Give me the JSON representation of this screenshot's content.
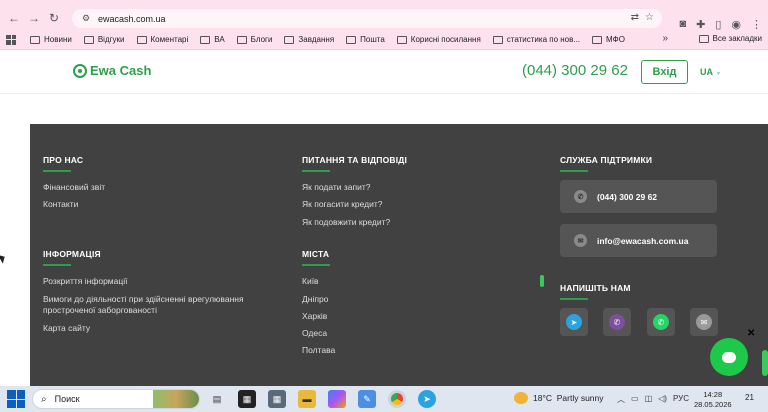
{
  "browser": {
    "url": "ewacash.com.ua",
    "bookmarks": [
      {
        "label": "Новини"
      },
      {
        "label": "Відгуки"
      },
      {
        "label": "Коментарі"
      },
      {
        "label": "ВА"
      },
      {
        "label": "Блоги"
      },
      {
        "label": "Завдання"
      },
      {
        "label": "Пошта"
      },
      {
        "label": "Корисні посилання"
      },
      {
        "label": "статистика по нов..."
      },
      {
        "label": "МФО"
      }
    ],
    "more_bookmarks": "»",
    "all_bookmarks": "Все закладки"
  },
  "header": {
    "logo_text": "Ewa Cash",
    "phone": "(044) 300 29 62",
    "login_label": "Вхід",
    "lang": "UA"
  },
  "footer": {
    "about": {
      "title": "ПРО НАС",
      "links": [
        "Фінансовий звіт",
        "Контакти"
      ]
    },
    "faq": {
      "title": "ПИТАННЯ ТА ВІДПОВІДІ",
      "links": [
        "Як подати запит?",
        "Як погасити кредит?",
        "Як подовжити кредит?"
      ]
    },
    "info": {
      "title": "ІНФОРМАЦІЯ",
      "links": [
        "Розкриття інформації",
        "Вимоги до діяльності при здійсненні врегулювання простроченої заборгованості",
        "Карта сайту"
      ]
    },
    "cities": {
      "title": "МІСТА",
      "links": [
        "Київ",
        "Дніпро",
        "Харків",
        "Одеса",
        "Полтава"
      ]
    },
    "support": {
      "title": "СЛУЖБА ПІДТРИМКИ",
      "phone": "(044) 300 29 62",
      "email": "info@ewacash.com.ua"
    },
    "write_us": {
      "title": "НАПИШІТЬ НАМ",
      "channels": [
        {
          "name": "telegram-icon",
          "color": "#2aa3df"
        },
        {
          "name": "viber-icon",
          "color": "#7b519d"
        },
        {
          "name": "whatsapp-icon",
          "color": "#25d366"
        },
        {
          "name": "email-icon",
          "color": "#999999"
        }
      ]
    }
  },
  "taskbar": {
    "search_placeholder": "Поиск",
    "weather_temp": "18°C",
    "weather_text": "Partly sunny",
    "lang": "РУС",
    "time": "14:28",
    "date": "28.05.2026",
    "notifications": "21"
  },
  "colors": {
    "brand_green": "#2e9e4b",
    "footer_bg": "#414141",
    "chrome_pink": "#fde2ee"
  }
}
